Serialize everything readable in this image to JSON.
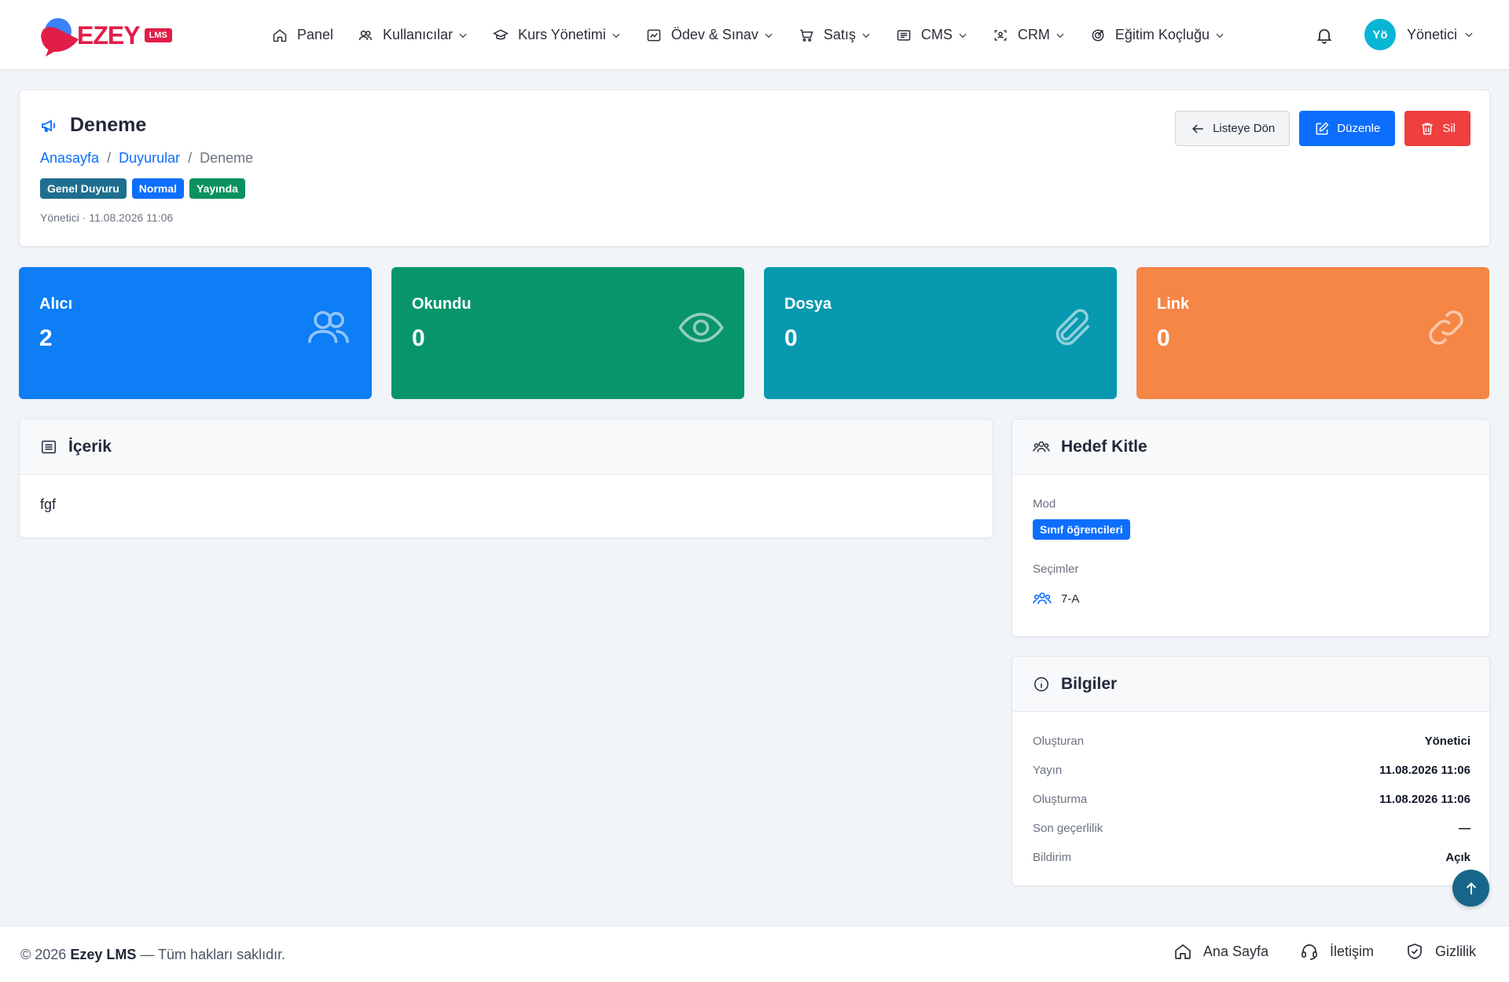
{
  "brand": {
    "name": "EZEY",
    "suffix": "LMS"
  },
  "nav": [
    {
      "label": "Panel",
      "icon": "home-icon"
    },
    {
      "label": "Kullanıcılar",
      "icon": "users-icon"
    },
    {
      "label": "Kurs Yönetimi",
      "icon": "graduation-cap-icon"
    },
    {
      "label": "Ödev & Sınav",
      "icon": "chart-icon"
    },
    {
      "label": "Satış",
      "icon": "cart-icon"
    },
    {
      "label": "CMS",
      "icon": "news-icon"
    },
    {
      "label": "CRM",
      "icon": "user-scan-icon"
    },
    {
      "label": "Eğitim Koçluğu",
      "icon": "target-icon"
    }
  ],
  "user": {
    "initials": "Yö",
    "name": "Yönetici",
    "avatar_color": "#06b6d4"
  },
  "header": {
    "title": "Deneme",
    "breadcrumb": {
      "home": "Anasayfa",
      "section": "Duyurular",
      "current": "Deneme",
      "separator": "/"
    },
    "badges": [
      {
        "label": "Genel Duyuru",
        "color": "#1e6f8f"
      },
      {
        "label": "Normal",
        "color": "#0d6efd"
      },
      {
        "label": "Yayında",
        "color": "#09915f"
      }
    ],
    "meta": "Yönetici · 11.08.2026 11:06",
    "actions": {
      "back": "Listeye Dön",
      "edit": "Düzenle",
      "delete": "Sil"
    }
  },
  "stats": [
    {
      "label": "Alıcı",
      "value": "2",
      "color": "#0d7ef5",
      "icon": "users-icon"
    },
    {
      "label": "Okundu",
      "value": "0",
      "color": "#09956a",
      "icon": "eye-icon"
    },
    {
      "label": "Dosya",
      "value": "0",
      "color": "#0799b0",
      "icon": "paperclip-icon"
    },
    {
      "label": "Link",
      "value": "0",
      "color": "#f58646",
      "icon": "link-icon"
    }
  ],
  "content": {
    "title": "İçerik",
    "body": "fgf"
  },
  "target": {
    "title": "Hedef Kitle",
    "mode_label": "Mod",
    "mode_value": "Sınıf öğrencileri",
    "selections_label": "Seçimler",
    "selections": [
      "7-A"
    ]
  },
  "info": {
    "title": "Bilgiler",
    "rows": [
      {
        "key": "Oluşturan",
        "value": "Yönetici"
      },
      {
        "key": "Yayın",
        "value": "11.08.2026 11:06"
      },
      {
        "key": "Oluşturma",
        "value": "11.08.2026 11:06"
      },
      {
        "key": "Son geçerlilik",
        "value": "—"
      },
      {
        "key": "Bildirim",
        "value": "Açık"
      }
    ]
  },
  "footer": {
    "copy_prefix": "© 2026",
    "copy_brand": "Ezey LMS",
    "copy_suffix": "— Tüm hakları saklıdır.",
    "links": [
      "Ana Sayfa",
      "İletişim",
      "Gizlilik"
    ]
  }
}
